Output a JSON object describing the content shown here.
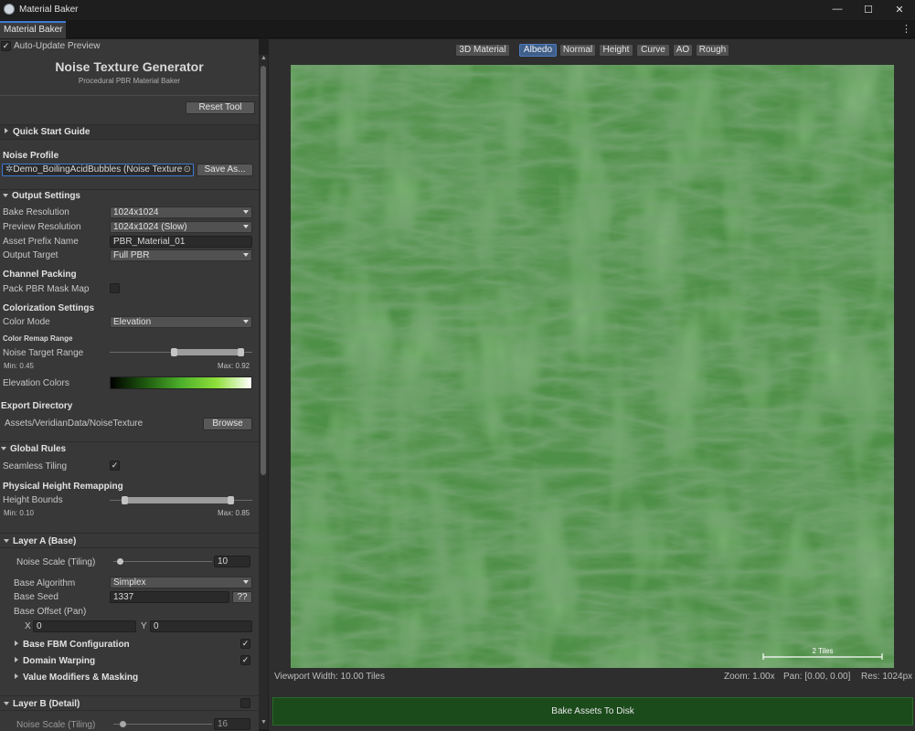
{
  "window": {
    "title": "Material Baker",
    "minimize_glyph": "—",
    "maximize_glyph": "☐",
    "close_glyph": "✕"
  },
  "tab": {
    "label": "Material Baker",
    "menu_glyph": "⋮"
  },
  "panel": {
    "auto_update": {
      "label": "Auto-Update Preview",
      "checked": true
    },
    "title": "Noise Texture Generator",
    "subtitle": "Procedural PBR Material Baker",
    "reset_button": "Reset Tool",
    "quick_start": "Quick Start Guide",
    "noise_profile": {
      "header": "Noise Profile",
      "value": "Demo_BoilingAcidBubbles (Noise Texture",
      "save_as": "Save As..."
    },
    "output": {
      "header": "Output Settings",
      "bake_resolution": {
        "label": "Bake Resolution",
        "value": "1024x1024"
      },
      "preview_resolution": {
        "label": "Preview Resolution",
        "value": "1024x1024 (Slow)"
      },
      "asset_prefix": {
        "label": "Asset Prefix Name",
        "value": "PBR_Material_01"
      },
      "output_target": {
        "label": "Output Target",
        "value": "Full PBR"
      }
    },
    "channel_packing": {
      "header": "Channel Packing",
      "pack_mask": {
        "label": "Pack PBR Mask Map",
        "checked": false
      }
    },
    "colorization": {
      "header": "Colorization Settings",
      "color_mode": {
        "label": "Color Mode",
        "value": "Elevation"
      },
      "remap_header": "Color Remap Range",
      "target_range": {
        "label": "Noise Target Range",
        "min_text": "Min: 0.45",
        "max_text": "Max: 0.92",
        "min": 0.45,
        "max": 0.92
      },
      "elevation_colors": {
        "label": "Elevation Colors",
        "gradient": [
          "#000000",
          "#1f5a0f",
          "#4caf2a",
          "#8fe03a",
          "#ffffff"
        ]
      }
    },
    "export": {
      "header": "Export Directory",
      "path": "Assets/VeridianData/NoiseTexture",
      "browse": "Browse"
    },
    "global_rules": {
      "header": "Global Rules",
      "seamless": {
        "label": "Seamless Tiling",
        "checked": true
      },
      "height_header": "Physical Height Remapping",
      "height_bounds": {
        "label": "Height Bounds",
        "min_text": "Min: 0.10",
        "max_text": "Max: 0.85",
        "min": 0.1,
        "max": 0.85
      }
    },
    "layer_a": {
      "header": "Layer A (Base)",
      "noise_scale": {
        "label": "Noise Scale (Tiling)",
        "value": "10",
        "fraction": 0.0
      },
      "algorithm": {
        "label": "Base Algorithm",
        "value": "Simplex"
      },
      "seed": {
        "label": "Base Seed",
        "value": "1337",
        "random_button": "??"
      },
      "offset": {
        "label": "Base Offset (Pan)",
        "x_label": "X",
        "x": "0",
        "y_label": "Y",
        "y": "0"
      },
      "fbm": {
        "label": "Base FBM Configuration",
        "checked": true
      },
      "warping": {
        "label": "Domain Warping",
        "checked": true
      },
      "modifiers": {
        "label": "Value Modifiers & Masking"
      }
    },
    "layer_b": {
      "header": "Layer B (Detail)",
      "enabled": false,
      "noise_scale": {
        "label": "Noise Scale (Tiling)",
        "value": "16"
      }
    }
  },
  "viewport": {
    "channels": [
      {
        "label": "3D Material",
        "active": false
      },
      {
        "label": "Albedo",
        "active": true
      },
      {
        "label": "Normal",
        "active": false
      },
      {
        "label": "Height",
        "active": false
      },
      {
        "label": "Curve",
        "active": false
      },
      {
        "label": "AO",
        "active": false
      },
      {
        "label": "Rough",
        "active": false
      }
    ],
    "scale_label": "2 Tiles",
    "width_text": "Viewport Width: 10.00 Tiles",
    "zoom_text": "Zoom: 1.00x",
    "pan_text": "Pan: [0.00, 0.00]",
    "res_text": "Res: 1024px",
    "texture_colors": {
      "base": "#4f9048",
      "light": "#6fb060",
      "dark": "#2f5f2a"
    }
  },
  "bake_button": "Bake Assets To Disk"
}
